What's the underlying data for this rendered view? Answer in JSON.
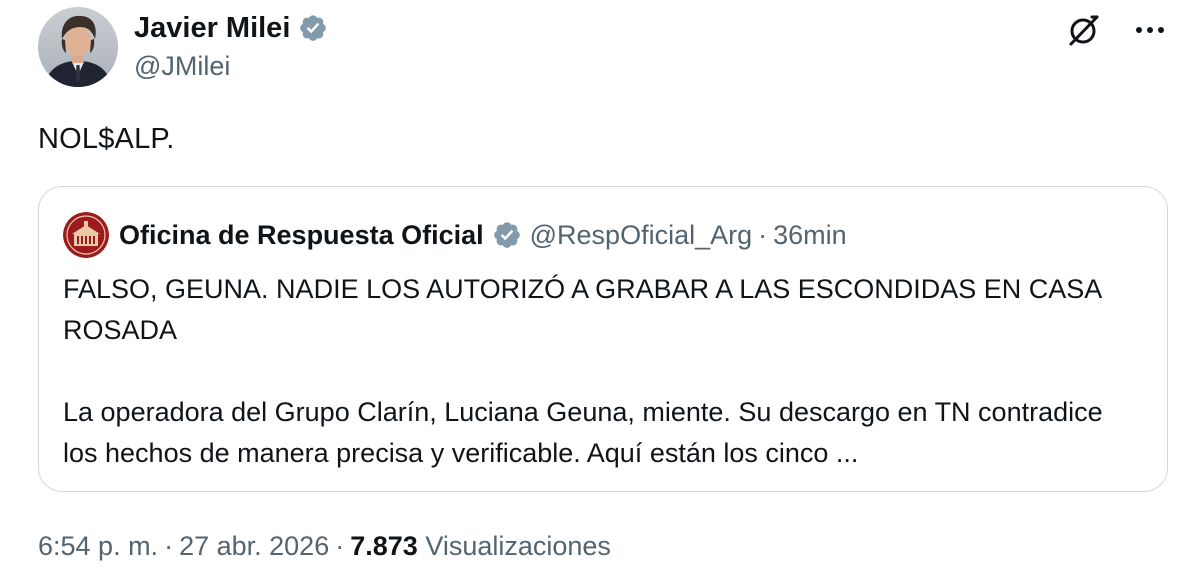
{
  "author": {
    "name": "Javier Milei",
    "handle": "@JMilei",
    "verified_color": "#829aab"
  },
  "actions": {
    "grok_icon": "grok-icon",
    "more_icon": "more-dots-icon"
  },
  "tweet": {
    "text": "NOL$ALP."
  },
  "quote": {
    "name": "Oficina de Respuesta Oficial",
    "handle": "@RespOficial_Arg",
    "separator": "·",
    "time": "36min",
    "verified_color": "#829aab",
    "avatar_color": "#9b1b1f",
    "body_line1": "FALSO, GEUNA. NADIE LOS AUTORIZÓ A GRABAR A LAS ESCONDIDAS EN CASA ROSADA",
    "body_line2": "La operadora del Grupo Clarín, Luciana Geuna, miente. Su descargo en TN contradice los hechos de manera precisa y verificable. Aquí están los cinco ..."
  },
  "meta": {
    "time": "6:54 p. m.",
    "separator": "·",
    "date": "27 abr. 2026",
    "views_count": "7.873",
    "views_label": "Visualizaciones"
  },
  "colors": {
    "text_primary": "#0f1419",
    "text_secondary": "#536471",
    "border": "#cfd9de"
  }
}
